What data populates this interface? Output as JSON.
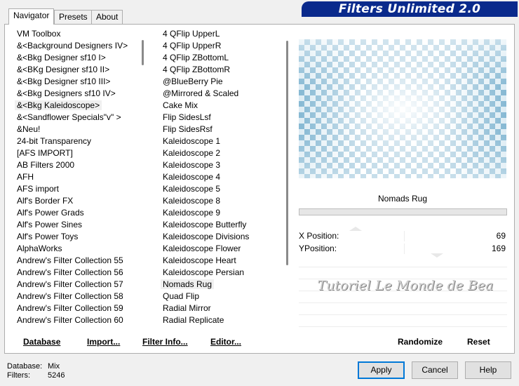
{
  "title": "Filters Unlimited 2.0",
  "tabs": [
    "Navigator",
    "Presets",
    "About"
  ],
  "categories": [
    "VM Toolbox",
    "&<Background Designers IV>",
    "&<Bkg Designer sf10 I>",
    "&<BKg Designer sf10 II>",
    "&<Bkg Designer sf10 III>",
    "&<Bkg Designers sf10 IV>",
    "&<Bkg Kaleidoscope>",
    "&<Sandflower Specials\"v\" >",
    "&Neu!",
    "24-bit Transparency",
    "[AFS IMPORT]",
    "AB Filters 2000",
    "AFH",
    "AFS import",
    "Alf's Border FX",
    "Alf's Power Grads",
    "Alf's Power Sines",
    "Alf's Power Toys",
    "AlphaWorks",
    "Andrew's Filter Collection 55",
    "Andrew's Filter Collection 56",
    "Andrew's Filter Collection 57",
    "Andrew's Filter Collection 58",
    "Andrew's Filter Collection 59",
    "Andrew's Filter Collection 60"
  ],
  "selected_category": "&<Bkg Kaleidoscope>",
  "filters": [
    "4 QFlip UpperL",
    "4 QFlip UpperR",
    "4 QFlip ZBottomL",
    "4 QFlip ZBottomR",
    "@BlueBerry Pie",
    "@Mirrored & Scaled",
    "Cake Mix",
    "Flip SidesLsf",
    "Flip SidesRsf",
    "Kaleidoscope 1",
    "Kaleidoscope 2",
    "Kaleidoscope 3",
    "Kaleidoscope 4",
    "Kaleidoscope 5",
    "Kaleidoscope 8",
    "Kaleidoscope 9",
    "Kaleidoscope Butterfly",
    "Kaleidoscope Divisions",
    "Kaleidoscope Flower",
    "Kaleidoscope Heart",
    "Kaleidoscope Persian",
    "Nomads Rug",
    "Quad Flip",
    "Radial Mirror",
    "Radial Replicate"
  ],
  "selected_filter": "Nomads Rug",
  "list_buttons": {
    "database": "Database",
    "import": "Import...",
    "filter_info": "Filter Info...",
    "editor": "Editor..."
  },
  "preview": {
    "filter_name": "Nomads Rug",
    "progress": 0
  },
  "params": [
    {
      "label": "X Position:",
      "value": "69"
    },
    {
      "label": "YPosition:",
      "value": "169"
    }
  ],
  "watermark": "Tutoriel Le Monde de Bea",
  "right_buttons": {
    "randomize": "Randomize",
    "reset": "Reset"
  },
  "footer": {
    "database_label": "Database:",
    "database_value": "Mix",
    "filters_label": "Filters:",
    "filters_value": "5246",
    "apply": "Apply",
    "cancel": "Cancel",
    "help": "Help"
  },
  "colors": {
    "banner": "#0a2a8c",
    "accent": "#0078d7"
  }
}
